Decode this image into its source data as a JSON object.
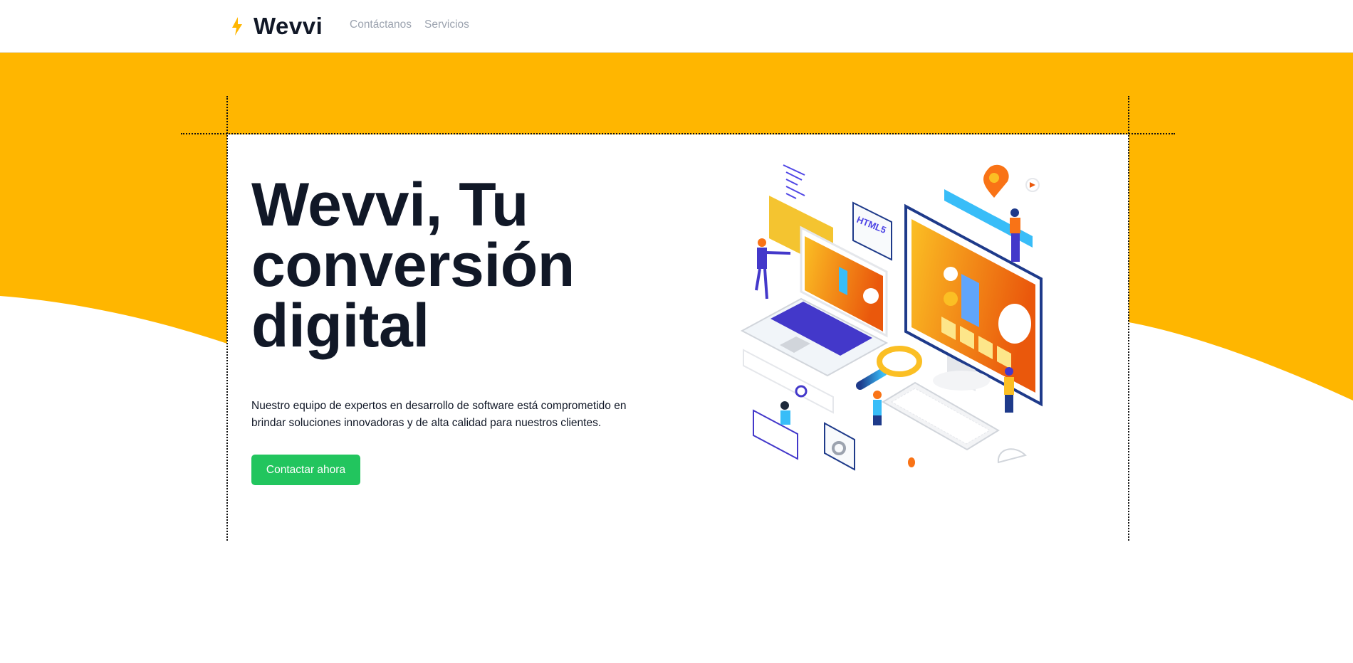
{
  "header": {
    "brand": "Wevvi",
    "logo_icon": "lightning-bolt-icon",
    "nav": [
      {
        "label": "Contáctanos"
      },
      {
        "label": "Servicios"
      }
    ]
  },
  "hero": {
    "title": "Wevvi, Tu conversión digital",
    "description": "Nuestro equipo de expertos en desarrollo de software está comprometido en brindar soluciones innovadoras y de alta calidad para nuestros clientes.",
    "cta_label": "Contactar ahora",
    "illustration_label": "HTML5"
  },
  "colors": {
    "brand_yellow": "#FFB600",
    "cta_green": "#22C55E",
    "text_dark": "#111827",
    "nav_gray": "#9CA3AF"
  }
}
